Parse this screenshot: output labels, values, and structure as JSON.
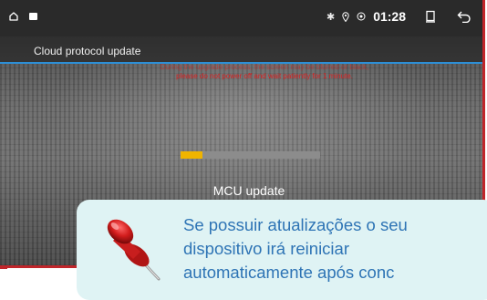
{
  "statusbar": {
    "icons_left": [
      "home-icon",
      "square-icon"
    ],
    "icons_right": [
      "bluetooth-icon",
      "location-icon",
      "wifi-icon"
    ],
    "time": "01:28",
    "recent_icon": "recent-apps-icon",
    "back_icon": "back-icon"
  },
  "header": {
    "title": "Cloud protocol update",
    "warning_line1": "During the upgrade process, the screen may be blurred or black,",
    "warning_line2": "please do not power off and wait patiently for 1 minute."
  },
  "progress": {
    "value": 0.16,
    "label": "MCU update",
    "fill_color": "#f0b400"
  },
  "callout": {
    "icon": "pushpin-icon",
    "text_line1": "Se possuir atualizações o seu",
    "text_line2": "dispositivo irá reiniciar",
    "text_line3": "automaticamente após conc",
    "text_color": "#2e74b5",
    "background": "#dff3f4"
  },
  "colors": {
    "accent_line": "#2d8fd6",
    "warning_text": "#d81e1e",
    "frame_border": "#c0262b"
  }
}
